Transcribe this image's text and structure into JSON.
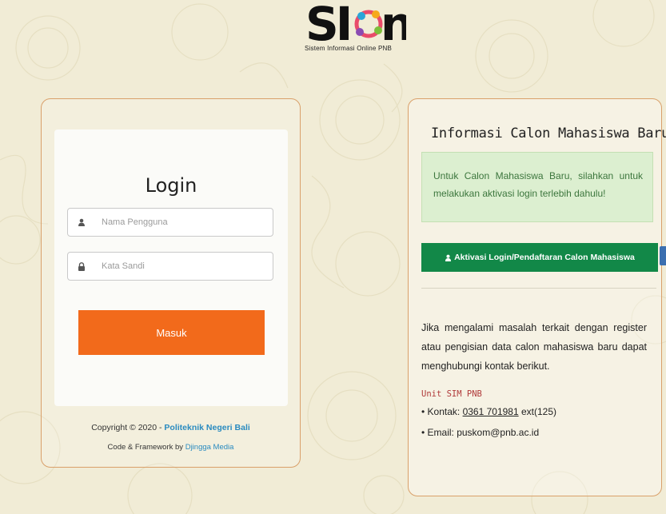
{
  "logo": {
    "text": "SION",
    "subtitle": "Sistem Informasi Online PNB"
  },
  "login": {
    "title": "Login",
    "username_placeholder": "Nama Pengguna",
    "password_placeholder": "Kata Sandi",
    "submit_label": "Masuk",
    "copyright_prefix": "Copyright © 2020 - ",
    "copyright_org": "Politeknik Negeri Bali",
    "credits_prefix": "Code & Framework by ",
    "credits_link": "Djingga Media"
  },
  "info": {
    "title": "Informasi Calon Mahasiswa Baru",
    "alert": "Untuk Calon Mahasiswa Baru, silahkan untuk melakukan aktivasi login terlebih dahulu!",
    "button_label": "Aktivasi Login/Pendaftaran Calon Mahasiswa",
    "help_text": "Jika mengalami masalah terkait dengan register atau pengisian data calon mahasiswa baru dapat menghubungi kontak berikut.",
    "unit": "Unit SIM PNB",
    "contact_prefix": "• Kontak: ",
    "phone": "0361 701981",
    "phone_ext": " ext(125)",
    "email": "• Email: puskom@pnb.ac.id"
  },
  "colors": {
    "background": "#f1ecd6",
    "accent_orange": "#f26a1b",
    "success_green": "#128848",
    "link_blue": "#2a8bc0"
  }
}
